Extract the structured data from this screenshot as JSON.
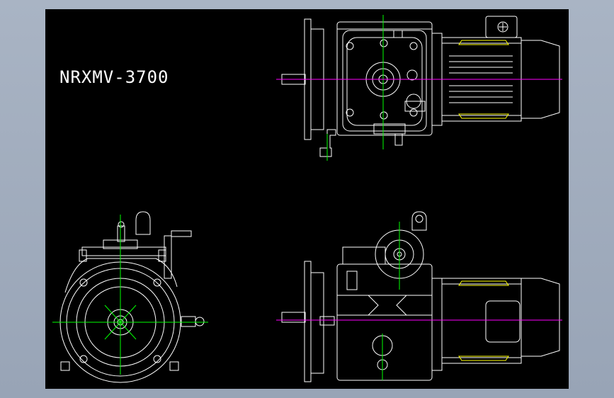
{
  "drawing": {
    "model_label": "NRXMV-3700",
    "colors": {
      "background": "#000000",
      "frame": "#a9b4c4",
      "outline": "#ffffff",
      "centerline": "#00ff00",
      "shaft_axis": "#ff00ff",
      "motor_highlight": "#ffff00"
    },
    "views": [
      "top-view",
      "side-view",
      "front-view"
    ]
  }
}
